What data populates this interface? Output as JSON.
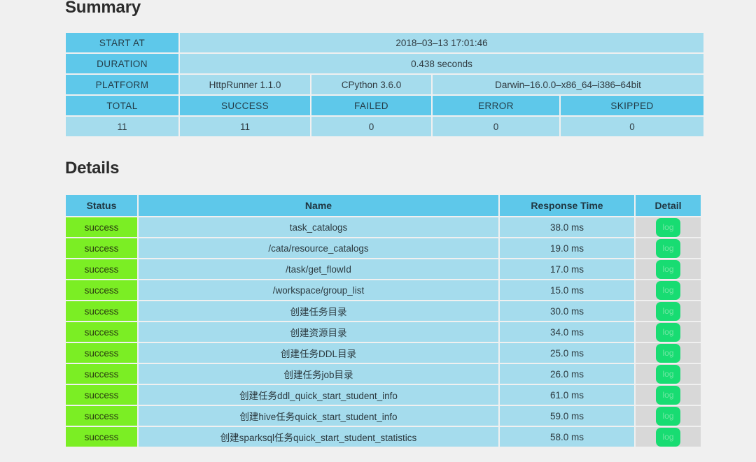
{
  "summary": {
    "heading": "Summary",
    "rows": {
      "start_at_label": "START AT",
      "start_at_value": "2018–03–13 17:01:46",
      "duration_label": "DURATION",
      "duration_value": "0.438 seconds",
      "platform_label": "PLATFORM",
      "platform_values": [
        "HttpRunner 1.1.0",
        "CPython 3.6.0",
        "Darwin–16.0.0–x86_64–i386–64bit"
      ],
      "stat_labels": [
        "TOTAL",
        "SUCCESS",
        "FAILED",
        "ERROR",
        "SKIPPED"
      ],
      "stat_values": [
        "11",
        "11",
        "0",
        "0",
        "0"
      ]
    }
  },
  "details": {
    "heading": "Details",
    "columns": [
      "Status",
      "Name",
      "Response Time",
      "Detail"
    ],
    "log_label": "log",
    "rows": [
      {
        "status": "success",
        "name": "task_catalogs",
        "response_time": "38.0 ms",
        "detail": "log"
      },
      {
        "status": "success",
        "name": "/cata/resource_catalogs",
        "response_time": "19.0 ms",
        "detail": "log"
      },
      {
        "status": "success",
        "name": "/task/get_flowId",
        "response_time": "17.0 ms",
        "detail": "log"
      },
      {
        "status": "success",
        "name": "/workspace/group_list",
        "response_time": "15.0 ms",
        "detail": "log"
      },
      {
        "status": "success",
        "name": "创建任务目录",
        "response_time": "30.0 ms",
        "detail": "log"
      },
      {
        "status": "success",
        "name": "创建资源目录",
        "response_time": "34.0 ms",
        "detail": "log"
      },
      {
        "status": "success",
        "name": "创建任务DDL目录",
        "response_time": "25.0 ms",
        "detail": "log"
      },
      {
        "status": "success",
        "name": "创建任务job目录",
        "response_time": "26.0 ms",
        "detail": "log"
      },
      {
        "status": "success",
        "name": "创建任务ddl_quick_start_student_info",
        "response_time": "61.0 ms",
        "detail": "log"
      },
      {
        "status": "success",
        "name": "创建hive任务quick_start_student_info",
        "response_time": "59.0 ms",
        "detail": "log"
      },
      {
        "status": "success",
        "name": "创建sparksql任务quick_start_student_statistics",
        "response_time": "58.0 ms",
        "detail": "log"
      }
    ]
  },
  "colors": {
    "page_background": "#f0f0f0",
    "header_blue": "#5ec8ea",
    "cell_blue": "#a5dced",
    "status_green": "#7bee24",
    "log_green": "#18dc72",
    "detail_cell_grey": "#d8d8d8"
  }
}
